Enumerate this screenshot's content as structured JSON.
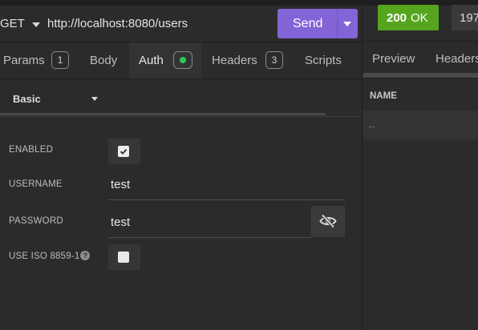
{
  "request": {
    "method": "GET",
    "url": "http://localhost:8080/users",
    "send_label": "Send"
  },
  "tabs": [
    {
      "label": "Params",
      "badge": "1"
    },
    {
      "label": "Body"
    },
    {
      "label": "Auth",
      "active": true,
      "indicator": "green-dot"
    },
    {
      "label": "Headers",
      "badge": "3"
    },
    {
      "label": "Scripts"
    }
  ],
  "auth": {
    "type_label": "Basic",
    "fields": {
      "enabled": {
        "label": "ENABLED",
        "checked": true
      },
      "username": {
        "label": "USERNAME",
        "value": "test"
      },
      "password": {
        "label": "PASSWORD",
        "value": "test"
      },
      "iso": {
        "label": "USE ISO 8859-1",
        "checked": false,
        "help": "?"
      }
    }
  },
  "response": {
    "status_code": "200",
    "status_text": "OK",
    "time": "197",
    "tabs": [
      {
        "label": "Preview"
      },
      {
        "label": "Headers"
      }
    ],
    "column_header": "NAME",
    "empty_cell": "--"
  },
  "colors": {
    "accent": "#8264d6",
    "status_ok": "#55a51f",
    "auth_dot": "#2ec85a",
    "background": "#2b2b2b"
  },
  "icons": {
    "method_dropdown": "chevron-down-icon",
    "send_dropdown": "chevron-down-icon",
    "auth_type_dropdown": "chevron-down-icon",
    "password_toggle": "eye-slash-icon",
    "checkbox": "check-icon",
    "help": "question-circle-icon"
  }
}
